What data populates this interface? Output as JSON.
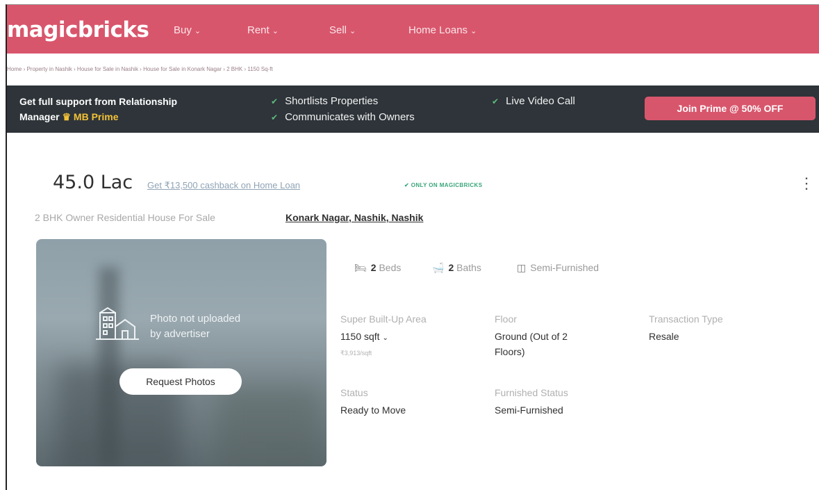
{
  "header": {
    "logo": "magicbricks",
    "nav": [
      "Buy",
      "Rent",
      "Sell",
      "Home Loans"
    ],
    "bg_color": "#d8566c"
  },
  "breadcrumb": "Home › Property in Nashik › House for Sale in Nashik › House for Sale in Konark Nagar › 2 BHK › 1150 Sq-ft",
  "prime": {
    "title_line1": "Get full support from Relationship",
    "title_line2": "Manager",
    "brand": "MB Prime",
    "features": [
      "Shortlists Properties",
      "Communicates with Owners",
      "Live Video Call"
    ],
    "button": "Join Prime @ 50% OFF"
  },
  "listing": {
    "price": "45.0 Lac",
    "cashback": "Get ₹13,500 cashback on Home Loan",
    "badge": "ONLY ON MAGICBRICKS",
    "subtitle": "2 BHK Owner Residential House For Sale",
    "location": "Konark Nagar, Nashik, Nashik"
  },
  "photo": {
    "message_line1": "Photo not uploaded",
    "message_line2": "by advertiser",
    "button": "Request Photos"
  },
  "amenities": {
    "beds_num": "2",
    "beds_label": "Beds",
    "baths_num": "2",
    "baths_label": "Baths",
    "furnishing": "Semi-Furnished"
  },
  "details": {
    "area_label": "Super Built-Up Area",
    "area_value": "1150 sqft",
    "area_rate": "₹3,913/sqft",
    "floor_label": "Floor",
    "floor_value_line1": "Ground (Out of 2",
    "floor_value_line2": "Floors)",
    "transaction_label": "Transaction Type",
    "transaction_value": "Resale",
    "status_label": "Status",
    "status_value": "Ready to Move",
    "furnished_label": "Furnished Status",
    "furnished_value": "Semi-Furnished"
  }
}
